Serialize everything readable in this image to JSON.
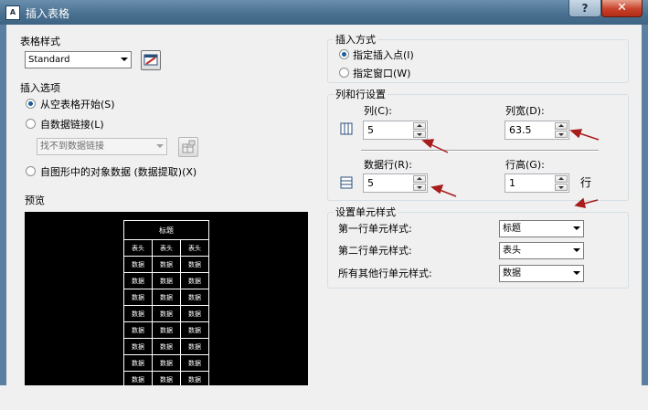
{
  "window": {
    "title": "插入表格",
    "help": "?",
    "close": "✕",
    "app_icon": "A"
  },
  "table_style": {
    "label": "表格样式",
    "value": "Standard"
  },
  "insert_options": {
    "label": "插入选项",
    "from_empty": "从空表格开始(S)",
    "from_data_link": "自数据链接(L)",
    "data_link_value": "找不到数据链接",
    "from_drawing": "自图形中的对象数据 (数据提取)(X)"
  },
  "preview": {
    "label": "预览",
    "title": "标题",
    "header": [
      "表头",
      "表头",
      "表头"
    ],
    "cell": "数据",
    "rows": 8
  },
  "insert_method": {
    "label": "插入方式",
    "point": "指定插入点(I)",
    "window": "指定窗口(W)"
  },
  "col_row": {
    "label": "列和行设置",
    "columns_label": "列(C):",
    "columns_value": "5",
    "col_width_label": "列宽(D):",
    "col_width_value": "63.5",
    "data_rows_label": "数据行(R):",
    "data_rows_value": "5",
    "row_height_label": "行高(G):",
    "row_height_value": "1",
    "row_unit": "行"
  },
  "cell_style": {
    "label": "设置单元样式",
    "first_row_label": "第一行单元样式:",
    "first_row_value": "标题",
    "second_row_label": "第二行单元样式:",
    "second_row_value": "表头",
    "other_rows_label": "所有其他行单元样式:",
    "other_rows_value": "数据"
  },
  "colors": {
    "accent_red": "#a81c1c",
    "title_bar": "#4b7192"
  }
}
